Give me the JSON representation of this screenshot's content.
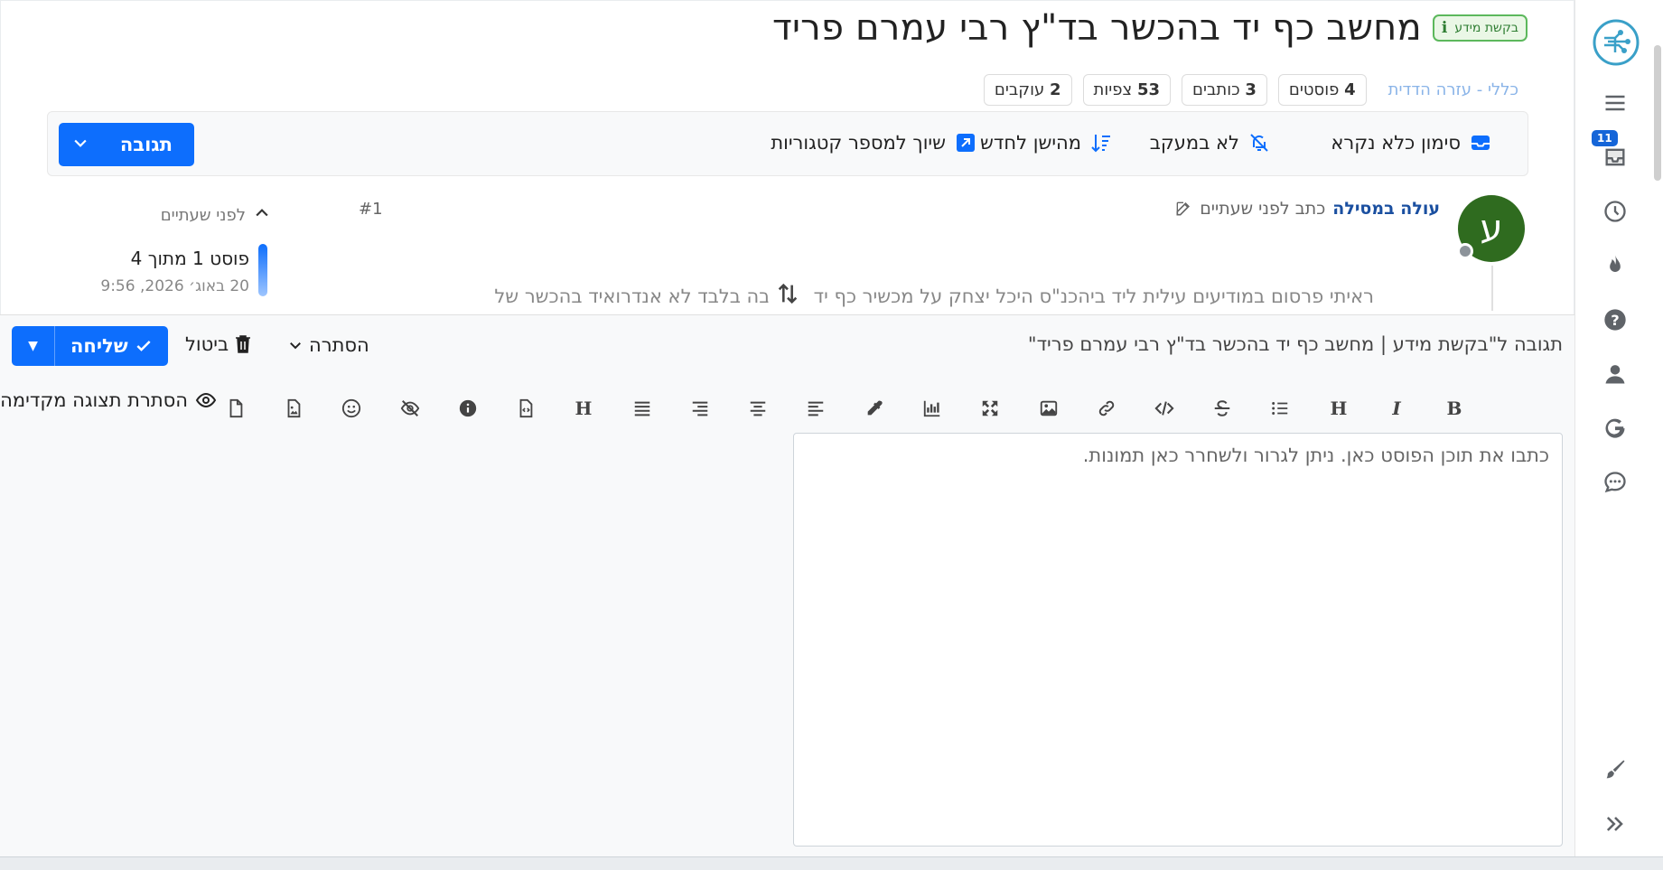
{
  "header": {
    "category_badge": "בקשת מידע",
    "title": "מחשב כף יד בהכשר בד\"ץ רבי עמרם פריד",
    "breadcrumb": "כללי - עזרה הדדית",
    "stats": [
      {
        "num": "4",
        "label": "פוסטים"
      },
      {
        "num": "3",
        "label": "כותבים"
      },
      {
        "num": "53",
        "label": "צפיות"
      },
      {
        "num": "2",
        "label": "עוקבים"
      }
    ]
  },
  "toolbar": {
    "mark_unread": "סימון כלא נקרא",
    "not_watching": "לא במעקב",
    "oldest_newest": "מהישן לחדש",
    "multi_category": "שיוך למספר קטגוריות",
    "reply": "תגובה"
  },
  "post": {
    "avatar_letter": "ע",
    "author": "עולה במסילה",
    "wrote": "כתב לפני שעתיים",
    "number": "#1",
    "body": "ראיתי פרסום במודיעים עילית ליד ביהכנ\"ס היכל יצחק על מכשיר כף יד לכתיבה בלבד לא אנדרואיד בהכשר של"
  },
  "timeline": {
    "top_label": "לפני שעתיים",
    "post_label": "פוסט 1 מתוך 4",
    "date": "20 באוג׳ 2026, 9:56"
  },
  "composer": {
    "title": "תגובה ל\"בקשת מידע | מחשב כף יד בהכשר בד\"ץ רבי עמרם פריד\"",
    "hide": "הסתרה",
    "cancel": "ביטול",
    "send": "שליחה",
    "preview_toggle": "הסתרת תצוגה מקדימה",
    "placeholder": "כתבו את תוכן הפוסט כאן. ניתן לגרור ולשחרר כאן תמונות."
  },
  "sidebar": {
    "notification_count": "11"
  },
  "colors": {
    "primary": "#0d6efd",
    "badge_green": "#5cb85c",
    "avatar": "#2f6b1f"
  }
}
